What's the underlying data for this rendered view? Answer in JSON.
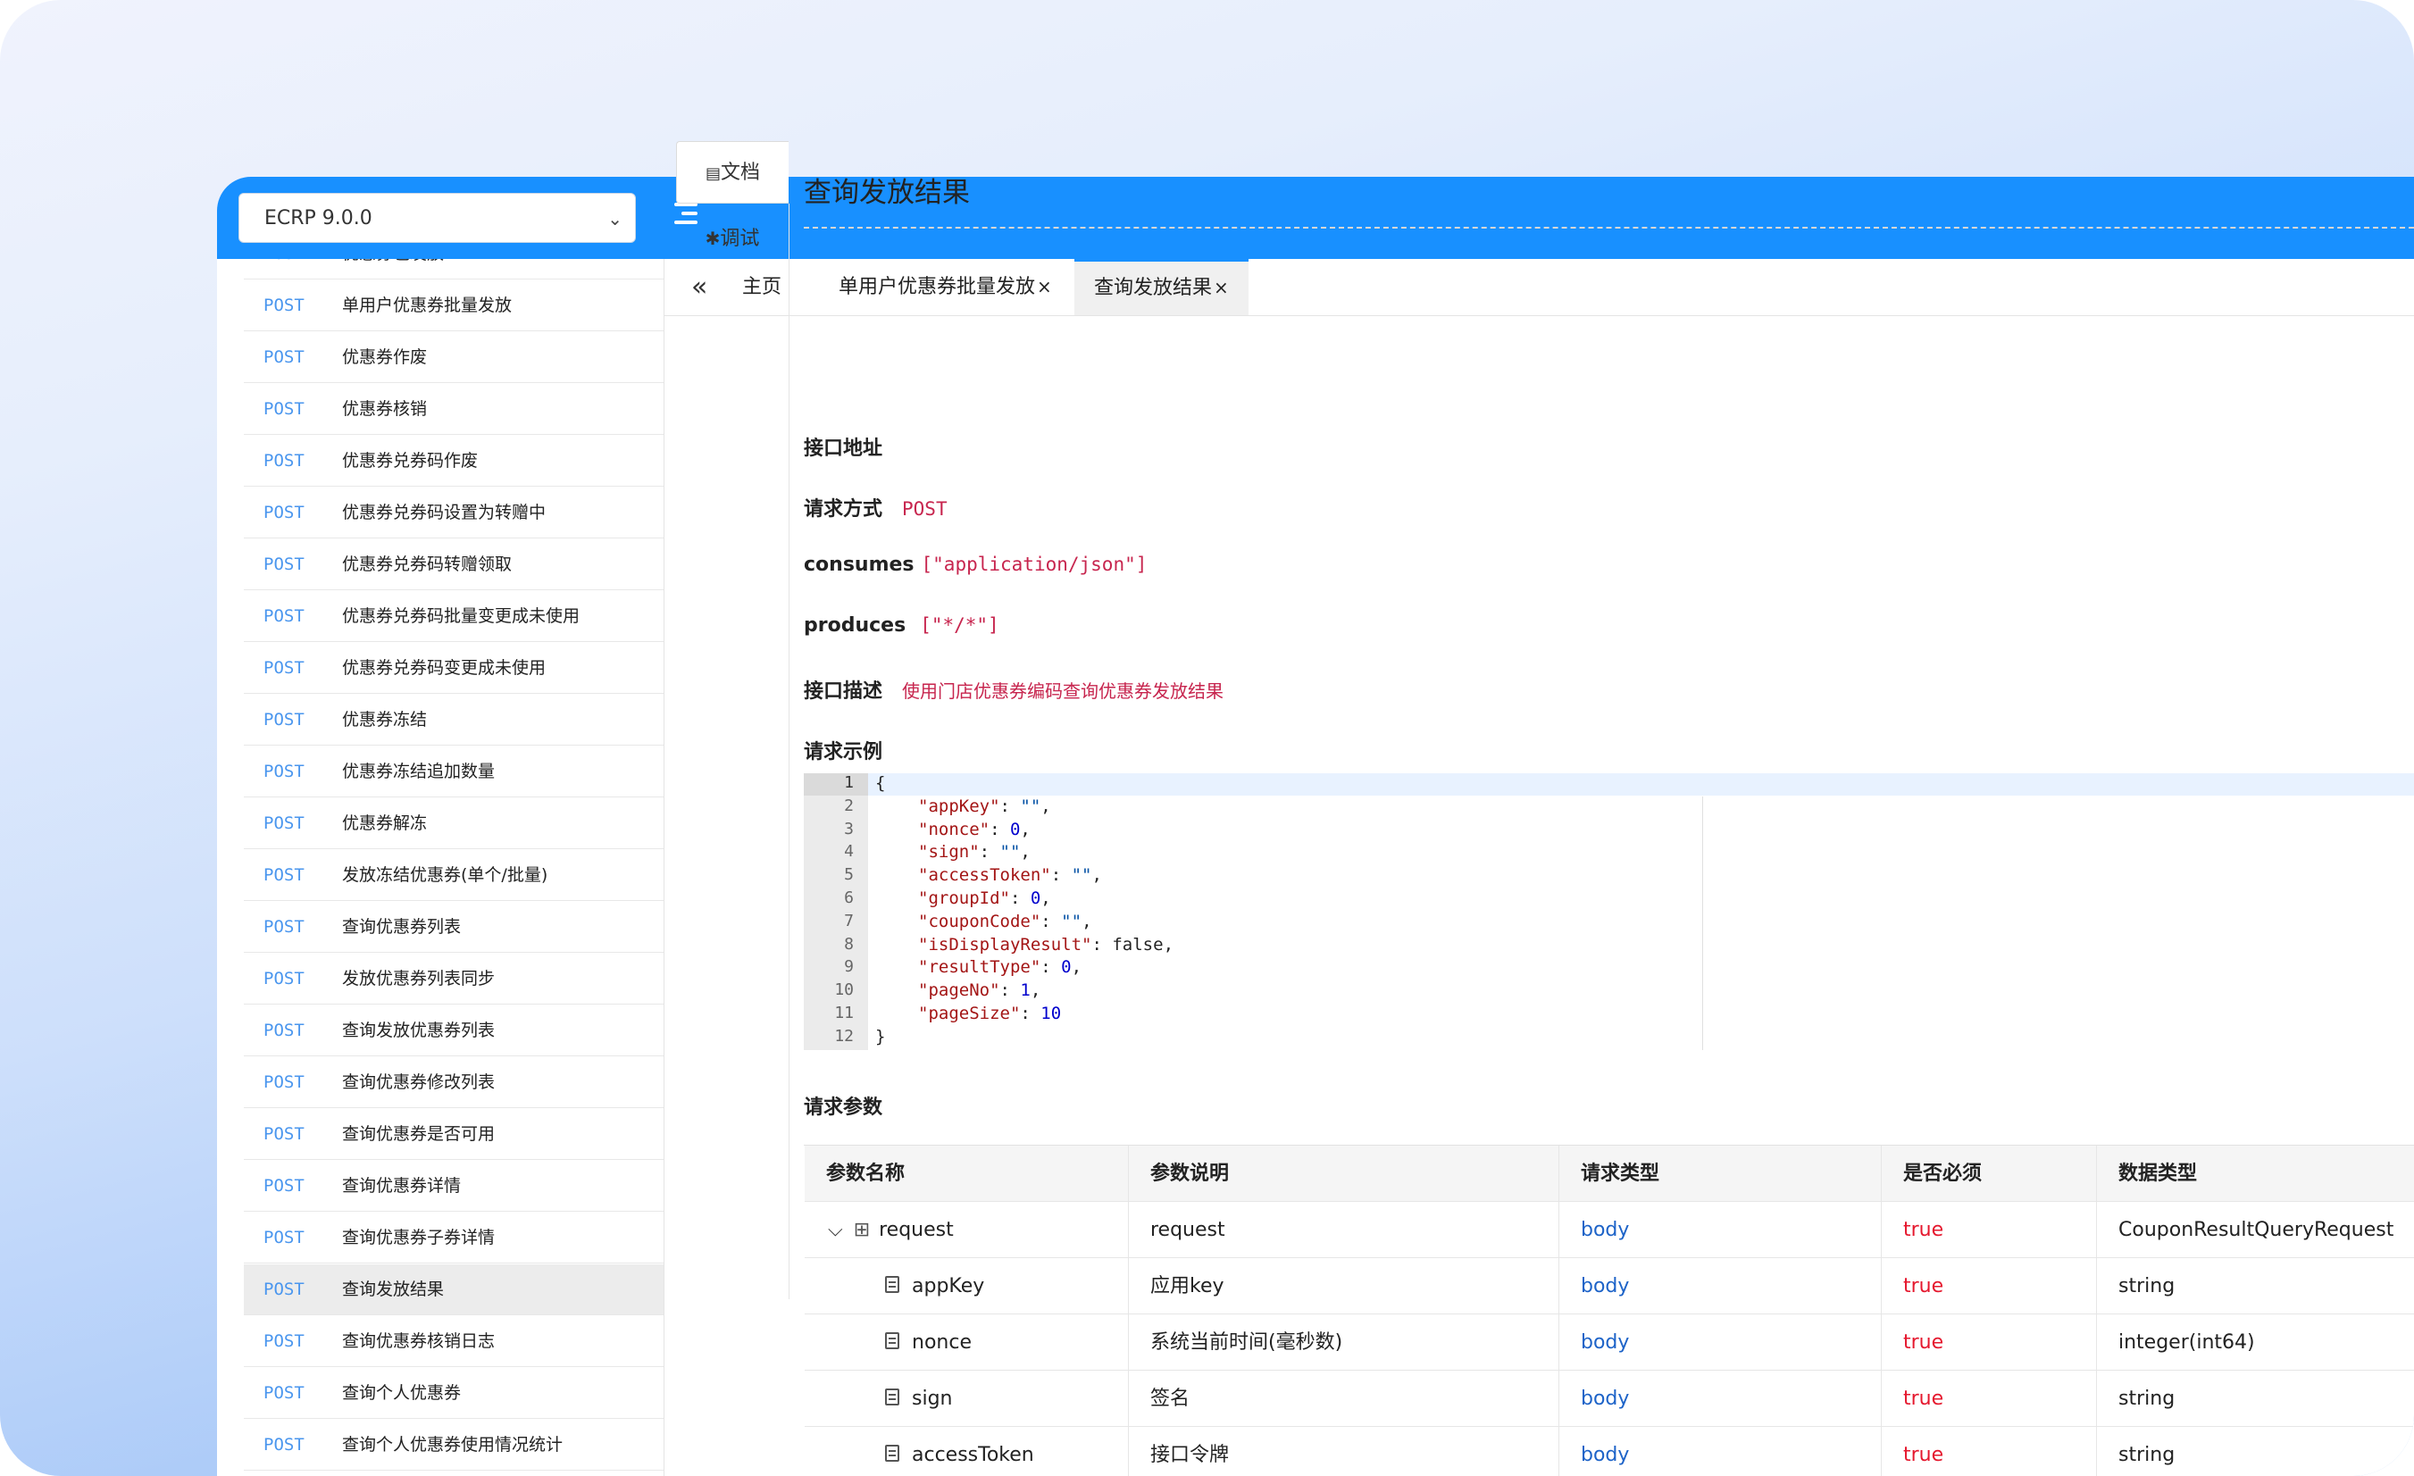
{
  "topbar": {
    "version": "ECRP 9.0.0"
  },
  "sidebar": {
    "items": [
      {
        "method": "POST",
        "label": "优惠券包发放"
      },
      {
        "method": "POST",
        "label": "单用户优惠券批量发放"
      },
      {
        "method": "POST",
        "label": "优惠券作废"
      },
      {
        "method": "POST",
        "label": "优惠券核销"
      },
      {
        "method": "POST",
        "label": "优惠券兑券码作废"
      },
      {
        "method": "POST",
        "label": "优惠券兑券码设置为转赠中"
      },
      {
        "method": "POST",
        "label": "优惠券兑券码转赠领取"
      },
      {
        "method": "POST",
        "label": "优惠券兑券码批量变更成未使用"
      },
      {
        "method": "POST",
        "label": "优惠券兑券码变更成未使用"
      },
      {
        "method": "POST",
        "label": "优惠券冻结"
      },
      {
        "method": "POST",
        "label": "优惠券冻结追加数量"
      },
      {
        "method": "POST",
        "label": "优惠券解冻"
      },
      {
        "method": "POST",
        "label": "发放冻结优惠券(单个/批量)"
      },
      {
        "method": "POST",
        "label": "查询优惠券列表"
      },
      {
        "method": "POST",
        "label": "发放优惠券列表同步"
      },
      {
        "method": "POST",
        "label": "查询发放优惠券列表"
      },
      {
        "method": "POST",
        "label": "查询优惠券修改列表"
      },
      {
        "method": "POST",
        "label": "查询优惠券是否可用"
      },
      {
        "method": "POST",
        "label": "查询优惠券详情"
      },
      {
        "method": "POST",
        "label": "查询优惠券子券详情"
      },
      {
        "method": "POST",
        "label": "查询发放结果"
      },
      {
        "method": "POST",
        "label": "查询优惠券核销日志"
      },
      {
        "method": "POST",
        "label": "查询个人优惠券"
      },
      {
        "method": "POST",
        "label": "查询个人优惠券使用情况统计"
      }
    ]
  },
  "tabs": [
    {
      "label": "主页"
    },
    {
      "label": "单用户优惠券批量发放",
      "close": "×"
    },
    {
      "label": "查询发放结果",
      "close": "×"
    }
  ],
  "side_tabs": {
    "doc": "文档",
    "debug": "调试"
  },
  "doc": {
    "title": "查询发放结果",
    "fields": {
      "address_label": "接口地址",
      "method_label": "请求方式",
      "method_value": "POST",
      "consumes_label": "consumes",
      "consumes_value": "[\"application/json\"]",
      "produces_label": "produces",
      "produces_value": "[\"*/*\"]",
      "desc_label": "接口描述",
      "desc_value": "使用门店优惠券编码查询优惠券发放结果",
      "example_label": "请求示例",
      "params_label": "请求参数"
    },
    "code": {
      "line_numbers": [
        "1",
        "2",
        "3",
        "4",
        "5",
        "6",
        "7",
        "8",
        "9",
        "10",
        "11",
        "12"
      ],
      "lines": [
        {
          "k": "",
          "v": "{"
        },
        {
          "k": "\"appKey\"",
          "v": "\"\"",
          "vt": "s",
          "comma": ","
        },
        {
          "k": "\"nonce\"",
          "v": "0",
          "vt": "n",
          "comma": ","
        },
        {
          "k": "\"sign\"",
          "v": "\"\"",
          "vt": "s",
          "comma": ","
        },
        {
          "k": "\"accessToken\"",
          "v": "\"\"",
          "vt": "s",
          "comma": ","
        },
        {
          "k": "\"groupId\"",
          "v": "0",
          "vt": "n",
          "comma": ","
        },
        {
          "k": "\"couponCode\"",
          "v": "\"\"",
          "vt": "s",
          "comma": ","
        },
        {
          "k": "\"isDisplayResult\"",
          "v": "false",
          "vt": "b",
          "comma": ","
        },
        {
          "k": "\"resultType\"",
          "v": "0",
          "vt": "n",
          "comma": ","
        },
        {
          "k": "\"pageNo\"",
          "v": "1",
          "vt": "n",
          "comma": ","
        },
        {
          "k": "\"pageSize\"",
          "v": "10",
          "vt": "n",
          "comma": ""
        },
        {
          "k": "",
          "v": "}"
        }
      ]
    },
    "table": {
      "headers": [
        "参数名称",
        "参数说明",
        "请求类型",
        "是否必须",
        "数据类型"
      ],
      "rows": [
        {
          "name": "request",
          "desc": "request",
          "in": "body",
          "required": "true",
          "type": "CouponResultQueryRequest"
        },
        {
          "name": "appKey",
          "desc": "应用key",
          "in": "body",
          "required": "true",
          "type": "string"
        },
        {
          "name": "nonce",
          "desc": "系统当前时间(毫秒数)",
          "in": "body",
          "required": "true",
          "type": "integer(int64)"
        },
        {
          "name": "sign",
          "desc": "签名",
          "in": "body",
          "required": "true",
          "type": "string"
        },
        {
          "name": "accessToken",
          "desc": "接口令牌",
          "in": "body",
          "required": "true",
          "type": "string"
        }
      ]
    }
  },
  "colors": {
    "topbar": "#1890ff",
    "method": "#4a96ee",
    "highlight_value": "#c7254e",
    "param_in": "#1d63c8",
    "required": "#e5182e"
  }
}
